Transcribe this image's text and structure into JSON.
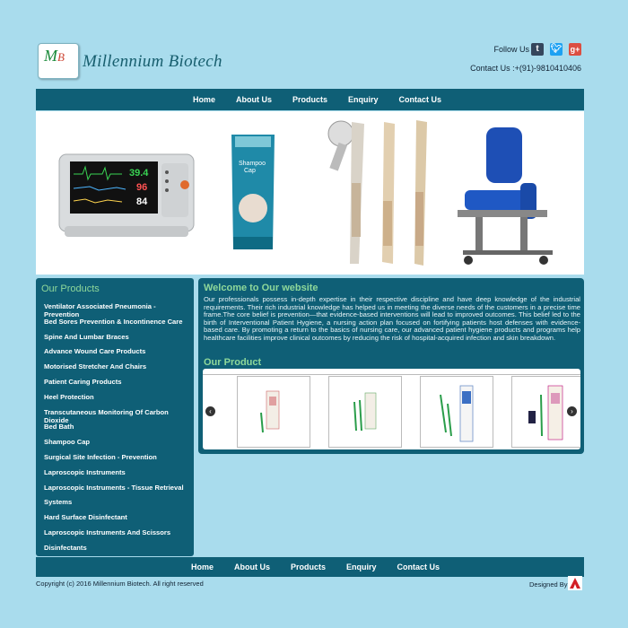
{
  "header": {
    "logo_text": "MB",
    "brand_name": "Millennium Biotech",
    "follow_label": "Follow Us",
    "social": [
      {
        "name": "tumblr",
        "glyph": "t",
        "color": "#35465c"
      },
      {
        "name": "twitter",
        "glyph": "t",
        "color": "#1da1f2"
      },
      {
        "name": "google-plus",
        "glyph": "g+",
        "color": "#dc4e41"
      }
    ],
    "contact": "Contact Us :+(91)-9810410406"
  },
  "nav": {
    "items": [
      "Home",
      "About Us",
      "Products",
      "Enquiry",
      "Contact Us"
    ]
  },
  "banner": {
    "monitor_readings": [
      "39.4",
      "96",
      "84"
    ]
  },
  "sidebar": {
    "title": "Our Products",
    "items": [
      "Ventilator Associated Pneumonia - Prevention",
      "Bed Sores Prevention & Incontinence Care",
      "Spine And Lumbar Braces",
      "Advance Wound Care Products",
      "Motorised Stretcher And Chairs",
      "Patient Caring Products",
      "Heel Protection",
      "Transcutaneous Monitoring Of Carbon Dioxide",
      "Bed Bath",
      "Shampoo Cap",
      "Surgical Site Infection - Prevention",
      "Laproscopic Instruments",
      "Laproscopic Instruments - Tissue Retrieval",
      "Systems",
      "Hard Surface Disinfectant",
      "Laproscopic Instruments And Scissors",
      "Disinfectants"
    ]
  },
  "main": {
    "welcome_title": "Welcome to Our website",
    "welcome_text": "Our professionals possess in-depth expertise in their respective discipline and have deep knowledge of the industrial requirements. Their rich industrial knowledge has helped us in meeting the diverse needs of the customers in a precise time frame.The core belief is prevention—that evidence-based interventions will lead to improved outcomes. This belief led to the birth of Interventional Patient Hygiene, a nursing action plan focused on fortifying patients host defenses with evidence-based care. By promoting a return to the basics of nursing care, our advanced patient hygiene products and programs help healthcare facilities improve clinical outcomes by reducing the risk of hospital-acquired infection and skin breakdown.",
    "product_title": "Our Product",
    "carousel_prev": "‹",
    "carousel_next": "›"
  },
  "footer": {
    "nav_items": [
      "Home",
      "About Us",
      "Products",
      "Enquiry",
      "Contact Us"
    ],
    "copyright": "Copyright (c) 2016 Millennium Biotech. All right reserved",
    "designed_by": "Designed By"
  },
  "colors": {
    "background": "#a9dced",
    "nav": "#0f5f76",
    "accent_green": "#8ed89a"
  }
}
